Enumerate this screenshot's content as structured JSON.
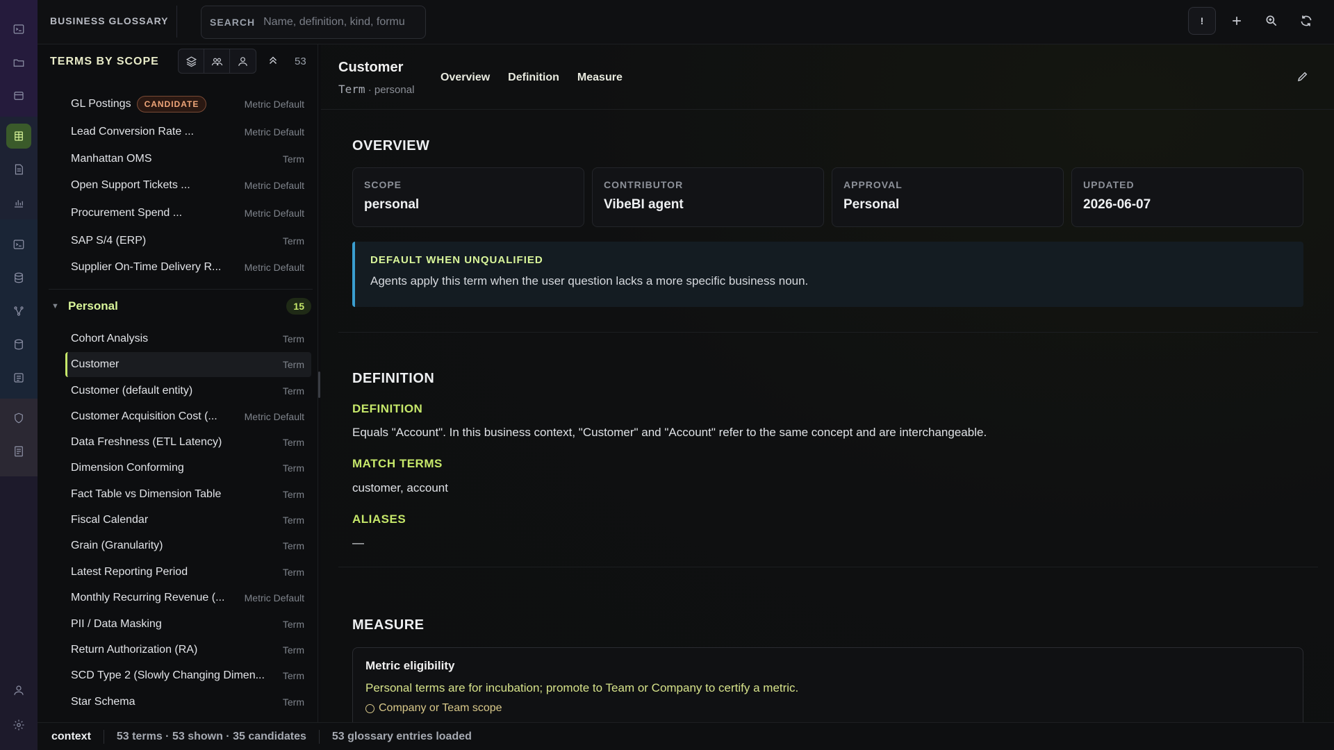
{
  "app": {
    "title": "BUSINESS GLOSSARY"
  },
  "search": {
    "label": "SEARCH",
    "placeholder": "Name, definition, kind, formu"
  },
  "top_actions": {
    "alert_label": "!"
  },
  "rail": {
    "items": [
      "terminal-icon",
      "folder-icon",
      "archive-icon",
      "glossary-icon",
      "document-icon",
      "chart-icon",
      "terminal-icon",
      "database-icon",
      "graph-icon",
      "database-icon",
      "list-icon",
      "shield-icon",
      "notes-icon",
      "user-icon",
      "gear-icon"
    ]
  },
  "terms_panel": {
    "title": "TERMS BY SCOPE",
    "total": "53",
    "team_items": [
      {
        "name": "GL Postings",
        "badge": "CANDIDATE",
        "kind": "Metric Default"
      },
      {
        "name": "Lead Conversion Rate  ...",
        "kind": "Metric Default"
      },
      {
        "name": "Manhattan OMS",
        "kind": "Term"
      },
      {
        "name": "Open Support Tickets  ...",
        "kind": "Metric Default"
      },
      {
        "name": "Procurement Spend  ...",
        "kind": "Metric Default"
      },
      {
        "name": "SAP S/4 (ERP)",
        "kind": "Term"
      },
      {
        "name": "Supplier On-Time Delivery R...",
        "kind": "Metric Default"
      }
    ],
    "group": {
      "name": "Personal",
      "count": "15"
    },
    "personal_items": [
      {
        "name": "Cohort Analysis",
        "kind": "Term"
      },
      {
        "name": "Customer",
        "kind": "Term"
      },
      {
        "name": "Customer (default entity)",
        "kind": "Term"
      },
      {
        "name": "Customer Acquisition Cost (...",
        "kind": "Metric Default"
      },
      {
        "name": "Data Freshness (ETL Latency)",
        "kind": "Term"
      },
      {
        "name": "Dimension Conforming",
        "kind": "Term"
      },
      {
        "name": "Fact Table vs Dimension Table",
        "kind": "Term"
      },
      {
        "name": "Fiscal Calendar",
        "kind": "Term"
      },
      {
        "name": "Grain (Granularity)",
        "kind": "Term"
      },
      {
        "name": "Latest Reporting Period",
        "kind": "Term"
      },
      {
        "name": "Monthly Recurring Revenue (...",
        "kind": "Metric Default"
      },
      {
        "name": "PII / Data Masking",
        "kind": "Term"
      },
      {
        "name": "Return Authorization (RA)",
        "kind": "Term"
      },
      {
        "name": "SCD Type 2 (Slowly Changing Dimen...",
        "kind": "Term"
      },
      {
        "name": "Star Schema",
        "kind": "Term"
      }
    ]
  },
  "detail": {
    "title": "Customer",
    "kind_mono": "Term",
    "scope_suffix": "· personal",
    "tabs": [
      "Overview",
      "Definition",
      "Measure"
    ],
    "overview": {
      "heading": "OVERVIEW",
      "cards": [
        {
          "label": "SCOPE",
          "value": "personal"
        },
        {
          "label": "CONTRIBUTOR",
          "value": "VibeBI agent"
        },
        {
          "label": "APPROVAL",
          "value": "Personal"
        },
        {
          "label": "UPDATED",
          "value": "2026-06-07"
        }
      ],
      "callout_title": "DEFAULT WHEN UNQUALIFIED",
      "callout_body": "Agents apply this term when the user question lacks a more specific business noun."
    },
    "definition": {
      "heading": "DEFINITION",
      "def_label": "DEFINITION",
      "def_text": "Equals \"Account\". In this business context, \"Customer\" and \"Account\" refer to the same concept and are interchangeable.",
      "match_label": "MATCH TERMS",
      "match_text": "customer, account",
      "aliases_label": "ALIASES",
      "aliases_text": "—"
    },
    "measure": {
      "heading": "MEASURE",
      "card_title": "Metric eligibility",
      "card_body": "Personal terms are for incubation; promote to Team or Company to certify a metric.",
      "requirement": "Company or Team scope"
    }
  },
  "footer": {
    "context": "context",
    "counts": "53 terms · 53 shown · 35 candidates",
    "loaded": "53 glossary entries loaded"
  }
}
